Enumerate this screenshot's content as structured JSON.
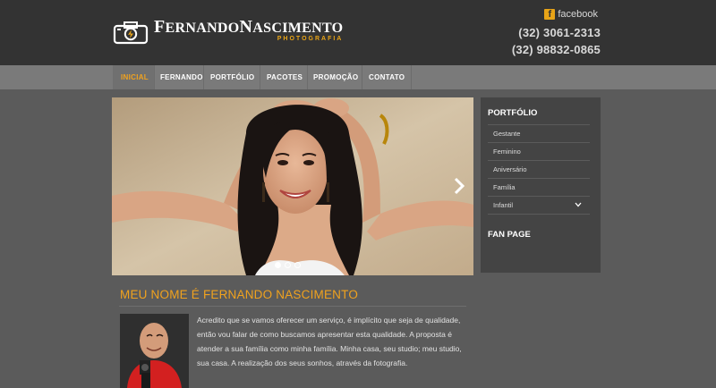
{
  "header": {
    "logo": {
      "name_cap1": "F",
      "name_rest1": "ERNANDO",
      "name_cap2": "N",
      "name_rest2": "ASCIMENTO",
      "subtitle": "PHOTOGRAFIA",
      "icon": "camera-logo-icon"
    },
    "facebook": {
      "icon": "facebook-icon",
      "label": "facebook"
    },
    "phones": [
      "(32) 3061-2313",
      "(32) 98832-0865"
    ]
  },
  "nav": {
    "items": [
      "INICIAL",
      "FERNANDO",
      "PORTFÓLIO",
      "PACOTES",
      "PROMOÇÃO",
      "CONTATO"
    ],
    "active_index": 0,
    "active_color": "#f0a21e"
  },
  "slider": {
    "next_icon": "chevron-right-icon",
    "dots": 3,
    "active_dot": 0
  },
  "sidebar": {
    "portfolio_title": "PORTFÓLIO",
    "portfolio_items": [
      "Gestante",
      "Feminino",
      "Aniversário",
      "Família",
      "Infantil"
    ],
    "fanpage_title": "FAN PAGE"
  },
  "content": {
    "title": "MEU NOME É FERNANDO NASCIMENTO",
    "text": "Acredito que se vamos oferecer um serviço, é implícito que seja de qualidade, então vou falar de como buscamos apresentar esta qualidade. A proposta é atender a sua família como minha família. Minha casa, seu studio; meu studio, sua casa. A realização dos seus sonhos, através da fotografia."
  },
  "colors": {
    "accent": "#f0a21e",
    "header_bg": "#333333",
    "nav_bg": "#7a7a7a",
    "page_bg": "#5b5b5b",
    "sidebar_bg": "#444444"
  }
}
